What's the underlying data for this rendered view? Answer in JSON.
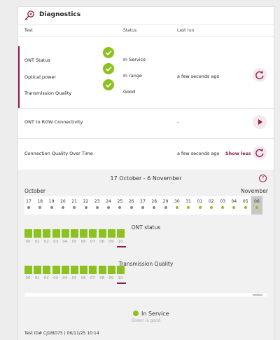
{
  "colors": {
    "accent": "#8c1d4a",
    "ok": "#8cc21f",
    "grey_dot": "#8a8a8a"
  },
  "header": {
    "title": "Diagnostics",
    "icon": "diagnostics-key-icon"
  },
  "table": {
    "columns": {
      "test": "Test",
      "status": "Status",
      "last_run": "Last run"
    },
    "group": {
      "rows": [
        {
          "label": "ONT Status",
          "status": "In Service"
        },
        {
          "label": "Optical power",
          "status": "In range"
        },
        {
          "label": "Transmission Quality",
          "status": "Good"
        }
      ],
      "last_run": "a few seconds ago",
      "action_icon": "rerun-icon"
    },
    "connectivity": {
      "label": "ONT to RGW Connectivity",
      "last_run": "-",
      "action_icon": "play-icon"
    },
    "quality": {
      "label": "Connection Quality Over Time",
      "last_run": "a few seconds ago",
      "toggle": "Show less",
      "action_icon": "rerun-icon"
    }
  },
  "timeline": {
    "range": "17 October - 6 November",
    "month_left": "October",
    "month_right": "November",
    "days": [
      "17",
      "18",
      "19",
      "20",
      "21",
      "22",
      "23",
      "24",
      "25",
      "26",
      "27",
      "28",
      "29",
      "30",
      "31",
      "01",
      "02",
      "03",
      "04",
      "05",
      "06"
    ],
    "day_status": [
      "none",
      "none",
      "none",
      "none",
      "none",
      "none",
      "none",
      "none",
      "none",
      "none",
      "none",
      "none",
      "none",
      "ok",
      "ok",
      "ok",
      "ok",
      "ok",
      "ok",
      "ok",
      "ok"
    ],
    "selected_index": 20,
    "hours": [
      "00",
      "01",
      "02",
      "03",
      "04",
      "05",
      "06",
      "07",
      "08",
      "09",
      "10"
    ],
    "current_hour_index": 10,
    "ont_title": "ONT status",
    "tq_title": "Transmission Quality"
  },
  "legend": {
    "label": "In Service",
    "sub": "Green is good"
  },
  "footer": {
    "test_id": "Test ID# CJ18ID75 | 06/11/25 10:14"
  }
}
